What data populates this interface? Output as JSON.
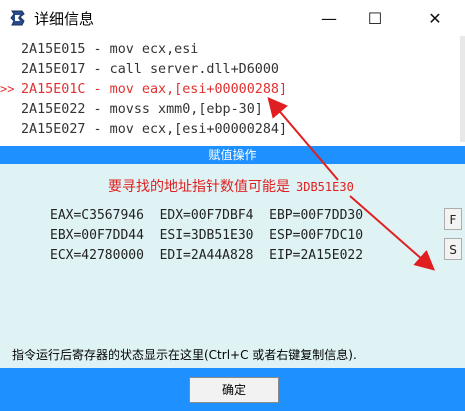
{
  "window": {
    "title": "详细信息",
    "minimize_symbol": "—",
    "maximize_symbol": "☐",
    "close_symbol": "✕"
  },
  "code": {
    "pointer": ">>",
    "lines": [
      "2A15E015 - mov ecx,esi",
      "2A15E017 - call server.dll+D6000",
      "2A15E01C - mov eax,[esi+00000288]",
      "2A15E022 - movss xmm0,[ebp-30]",
      "2A15E027 - mov ecx,[esi+00000284]"
    ],
    "current_line_index": 2
  },
  "section": {
    "header": "赋值操作"
  },
  "annotation": {
    "text": "要寻找的地址指针数值可能是",
    "address": "3DB51E30",
    "color": "#e02020"
  },
  "registers": {
    "rows": [
      "EAX=C3567946  EDX=00F7DBF4  EBP=00F7DD30",
      "EBX=00F7DD44  ESI=3DB51E30  ESP=00F7DC10",
      "ECX=42780000  EDI=2A44A828  EIP=2A15E022"
    ]
  },
  "side_buttons": {
    "f_label": "F",
    "s_label": "S"
  },
  "status": {
    "text": "指令运行后寄存器的状态显示在这里(Ctrl+C 或者右键复制信息)."
  },
  "footer": {
    "ok_label": "确定"
  },
  "colors": {
    "accent": "#1e90ff",
    "panel": "#dff3f5",
    "highlight": "#e03131"
  }
}
